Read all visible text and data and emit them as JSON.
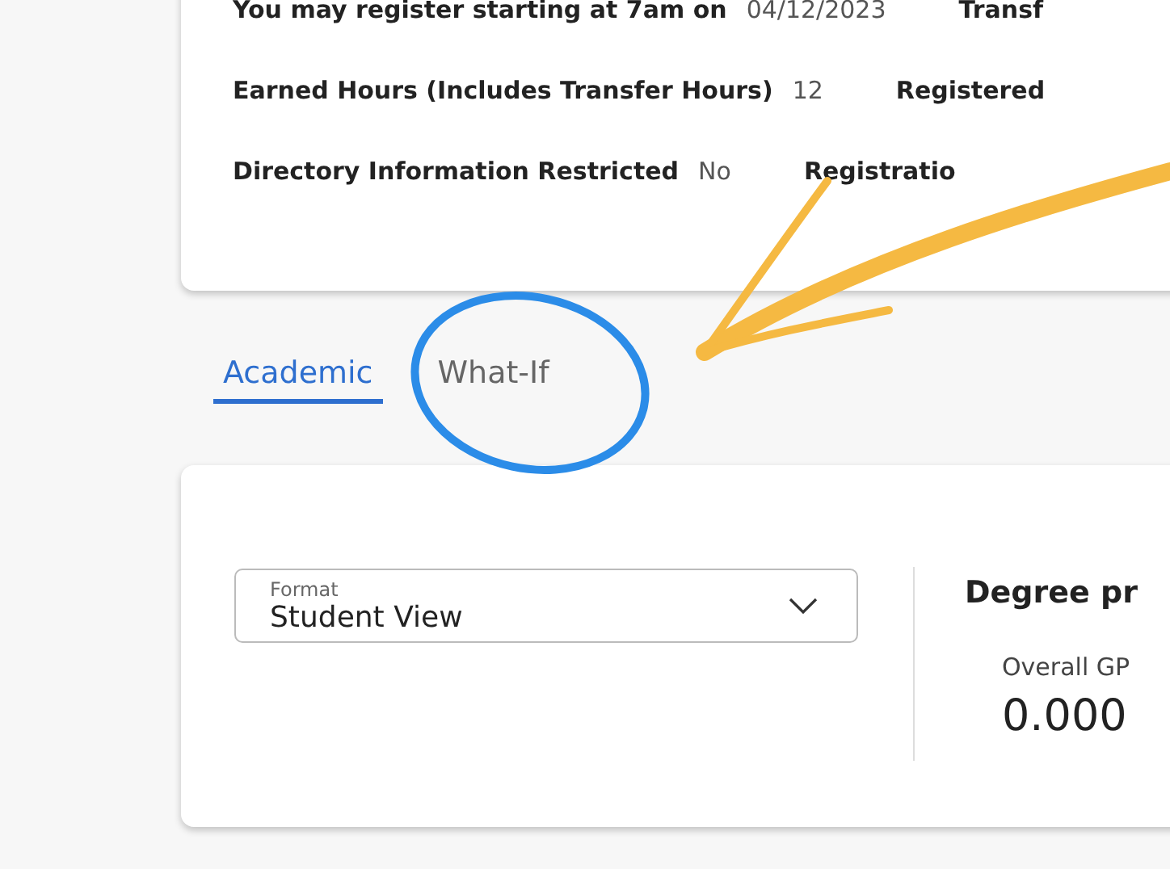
{
  "summary": {
    "rows": [
      {
        "label": "You may register starting at 7am on",
        "value": "04/12/2023",
        "next_label": "Transf"
      },
      {
        "label": "Earned Hours (Includes Transfer Hours)",
        "value": "12",
        "next_label": "Registered"
      },
      {
        "label": "Directory Information Restricted",
        "value": "No",
        "next_label": "Registratio"
      }
    ]
  },
  "tabs": [
    {
      "label": "Academic",
      "selected": true
    },
    {
      "label": "What-If",
      "selected": false
    }
  ],
  "format_select": {
    "label": "Format",
    "value": "Student View"
  },
  "degree_progress": {
    "title": "Degree pr",
    "gpa_label": "Overall GP",
    "gpa_value": "0.000"
  }
}
